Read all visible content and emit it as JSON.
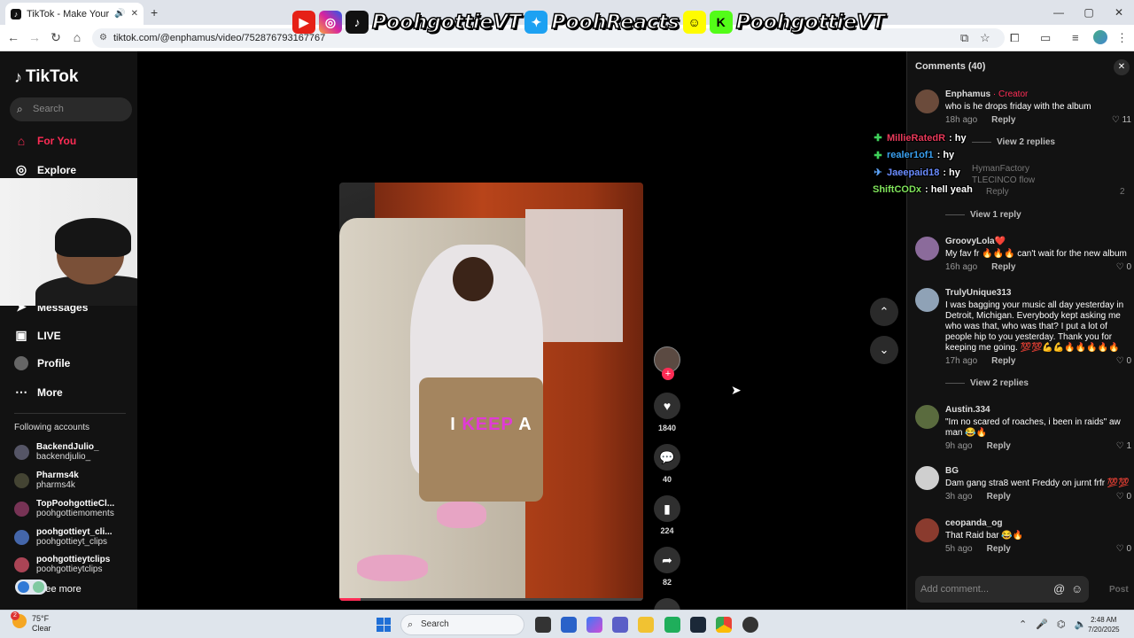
{
  "browser": {
    "tab_title": "TikTok - Make Your Day",
    "url": "tiktok.com/@enphamus/video/752876793167767"
  },
  "overlay": {
    "handle1": "PoohgottieVT",
    "handle2": "PoohReacts",
    "handle3": "PoohgottieVT"
  },
  "sidebar": {
    "logo": "TikTok",
    "search_placeholder": "Search",
    "nav": [
      {
        "label": "For You",
        "icon": "home-icon"
      },
      {
        "label": "Explore",
        "icon": "compass-icon"
      },
      {
        "label": "Messages",
        "icon": "send-icon"
      },
      {
        "label": "LIVE",
        "icon": "live-icon"
      },
      {
        "label": "Profile",
        "icon": "avatar"
      },
      {
        "label": "More",
        "icon": "more-icon"
      }
    ],
    "following_title": "Following accounts",
    "accounts": [
      {
        "name": "BackendJulio_",
        "handle": "backendjulio_"
      },
      {
        "name": "Pharms4k",
        "handle": "pharms4k"
      },
      {
        "name": "TopPoohgottieCl...",
        "handle": "poohgottiemoments"
      },
      {
        "name": "poohgottieyt_cli...",
        "handle": "poohgottieyt_clips"
      },
      {
        "name": "poohgottieytclips",
        "handle": "poohgottieytclips"
      }
    ],
    "see_more": "See more"
  },
  "video": {
    "caption_pre": "I",
    "caption_hl": "KEEP",
    "caption_post": "A",
    "progress_fraction": 0.07,
    "likes": "1840",
    "comments": "40",
    "saves": "224",
    "shares": "82"
  },
  "chat": [
    {
      "user": "MillieRatedR",
      "color": "#e83a5a",
      "badge": "✚",
      "badge_color": "#3fd05a",
      "msg": ": hy"
    },
    {
      "user": "realer1of1",
      "color": "#3aa0f0",
      "badge": "✚",
      "badge_color": "#3fd05a",
      "msg": ": hy"
    },
    {
      "user": "Jaeepaid18",
      "color": "#6a8cff",
      "badge": "✈",
      "badge_color": "#5fa8ff",
      "msg": ": hy"
    },
    {
      "user": "ShiftCODx",
      "color": "#7fe35a",
      "badge": "",
      "badge_color": "#3fd05a",
      "msg": ": hell yeah"
    }
  ],
  "comments": {
    "header": "Comments (40)",
    "items": [
      {
        "user": "Enphamus",
        "creator": " · Creator",
        "text": "who is he drops friday with the album",
        "time": "18h ago",
        "reply": "Reply",
        "likes": "11"
      },
      {
        "user": "GroovyLola❤️",
        "creator": "",
        "text": "My fav fr 🔥🔥🔥 can't wait for the new album",
        "time": "16h ago",
        "reply": "Reply",
        "likes": "0"
      },
      {
        "user": "TrulyUnique313",
        "creator": "",
        "text": "I was bagging your music all day yesterday in Detroit, Michigan. Everybody kept asking me who was that, who was that? I put a lot of people hip to you yesterday. Thank you for keeping me going. 💯💯💪💪🔥🔥🔥🔥🔥",
        "time": "17h ago",
        "reply": "Reply",
        "likes": "0"
      },
      {
        "user": "Austin.334",
        "creator": "",
        "text": "\"Im no scared of roaches, i been in raids\" aw man 😂🔥",
        "time": "9h ago",
        "reply": "Reply",
        "likes": "1"
      },
      {
        "user": "BG",
        "creator": "",
        "text": "Dam gang stra8 went Freddy on jurnt frfr 💯💯",
        "time": "3h ago",
        "reply": "Reply",
        "likes": "0"
      },
      {
        "user": "ceopanda_og",
        "creator": "",
        "text": "That Raid bar 😂🔥",
        "time": "5h ago",
        "reply": "Reply",
        "likes": "0"
      }
    ],
    "view_replies_1": "View 2 replies",
    "ghost_user": "HymanFactory",
    "ghost_text": "TLECINCO flow",
    "ghost_reply": "Reply",
    "ghost_likes": "2",
    "view_reply_2": "View 1 reply",
    "view_replies_3": "View 2 replies",
    "add_placeholder": "Add comment...",
    "post": "Post"
  },
  "taskbar": {
    "temp": "75°F",
    "cond": "Clear",
    "weather_badge": "2",
    "search": "Search",
    "time": "2:48 AM",
    "date": "7/20/2025"
  }
}
